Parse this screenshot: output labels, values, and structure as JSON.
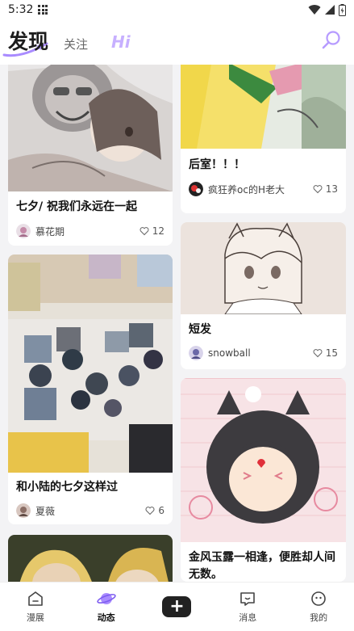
{
  "status": {
    "time": "5:32"
  },
  "header": {
    "tabs": [
      {
        "label": "发现",
        "active": true
      },
      {
        "label": "关注",
        "active": false
      },
      {
        "label": "Hi",
        "active": false
      }
    ]
  },
  "feed": {
    "left": [
      {
        "title": "七夕/ 祝我们永远在一起",
        "author": "慕花期",
        "likes": "12"
      },
      {
        "title": "和小陆的七夕这样过",
        "author": "夏薇",
        "likes": "6"
      },
      {
        "title": "",
        "author": "",
        "likes": ""
      }
    ],
    "right": [
      {
        "title": "后室！！！",
        "author": "疯狂养oc的H老大",
        "likes": "13"
      },
      {
        "title": "短发",
        "author": "snowball",
        "likes": "15"
      },
      {
        "title": "金风玉露一相逢，便胜却人间无数。",
        "author": "",
        "likes": ""
      }
    ]
  },
  "tabbar": {
    "items": [
      {
        "label": "漫展",
        "icon": "house-icon"
      },
      {
        "label": "动态",
        "icon": "planet-icon",
        "active": true
      },
      {
        "label": "",
        "icon": "plus-icon"
      },
      {
        "label": "消息",
        "icon": "message-icon"
      },
      {
        "label": "我的",
        "icon": "profile-icon"
      }
    ]
  },
  "colors": {
    "accent": "#c7b0ff",
    "background": "#f3f3f5"
  }
}
